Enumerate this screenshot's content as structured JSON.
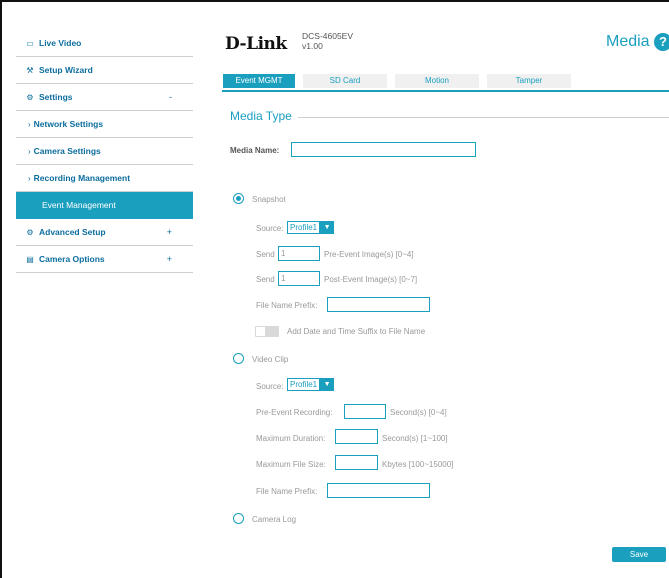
{
  "header": {
    "logo": "D-Link",
    "model": "DCS-4605EV",
    "version": "v1.00",
    "page_title": "Media",
    "help_glyph": "?"
  },
  "sidebar": {
    "items": [
      {
        "label": "Live Video",
        "icon": "video-icon"
      },
      {
        "label": "Setup Wizard",
        "icon": "wand-icon"
      },
      {
        "label": "Settings",
        "icon": "gear-icon",
        "toggle": "-"
      },
      {
        "label": "Network Settings",
        "sub": true
      },
      {
        "label": "Camera Settings",
        "sub": true
      },
      {
        "label": "Recording Management",
        "sub": true
      },
      {
        "label": "Event Management",
        "active": true
      },
      {
        "label": "Advanced Setup",
        "icon": "advanced-gear-icon",
        "toggle": "+"
      },
      {
        "label": "Camera Options",
        "icon": "list-icon",
        "toggle": "+"
      }
    ]
  },
  "tabs": [
    "Event MGMT",
    "SD Card",
    "Motion",
    "Tamper"
  ],
  "active_tab": "Event MGMT",
  "section_title": "Media Type",
  "media_name": {
    "label": "Media Name:",
    "value": ""
  },
  "snapshot": {
    "label": "Snapshot",
    "selected": true,
    "source_label": "Source:",
    "source_value": "Profile1",
    "send1_label": "Send",
    "pre_value": "1",
    "pre_suffix": "Pre-Event Image(s) [0~4]",
    "send2_label": "Send",
    "post_value": "1",
    "post_suffix": "Post-Event Image(s) [0~7]",
    "prefix_label": "File Name Prefix:",
    "prefix_value": "",
    "suffix_toggle_label": "Add Date and Time Suffix to File Name"
  },
  "video_clip": {
    "label": "Video Clip",
    "selected": false,
    "source_label": "Source:",
    "source_value": "Profile1",
    "pre_label": "Pre-Event Recording:",
    "pre_value": "",
    "pre_suffix": "Second(s) [0~4]",
    "duration_label": "Maximum Duration:",
    "duration_value": "",
    "duration_suffix": "Second(s) [1~100]",
    "size_label": "Maximum File Size:",
    "size_value": "",
    "size_suffix": "Kbytes [100~15000]",
    "prefix_label": "File Name Prefix:",
    "prefix_value": ""
  },
  "camera_log": {
    "label": "Camera Log",
    "selected": false
  },
  "save_label": "Save",
  "colors": {
    "accent": "#1a9fbf",
    "nav_text": "#0b6d9e"
  }
}
